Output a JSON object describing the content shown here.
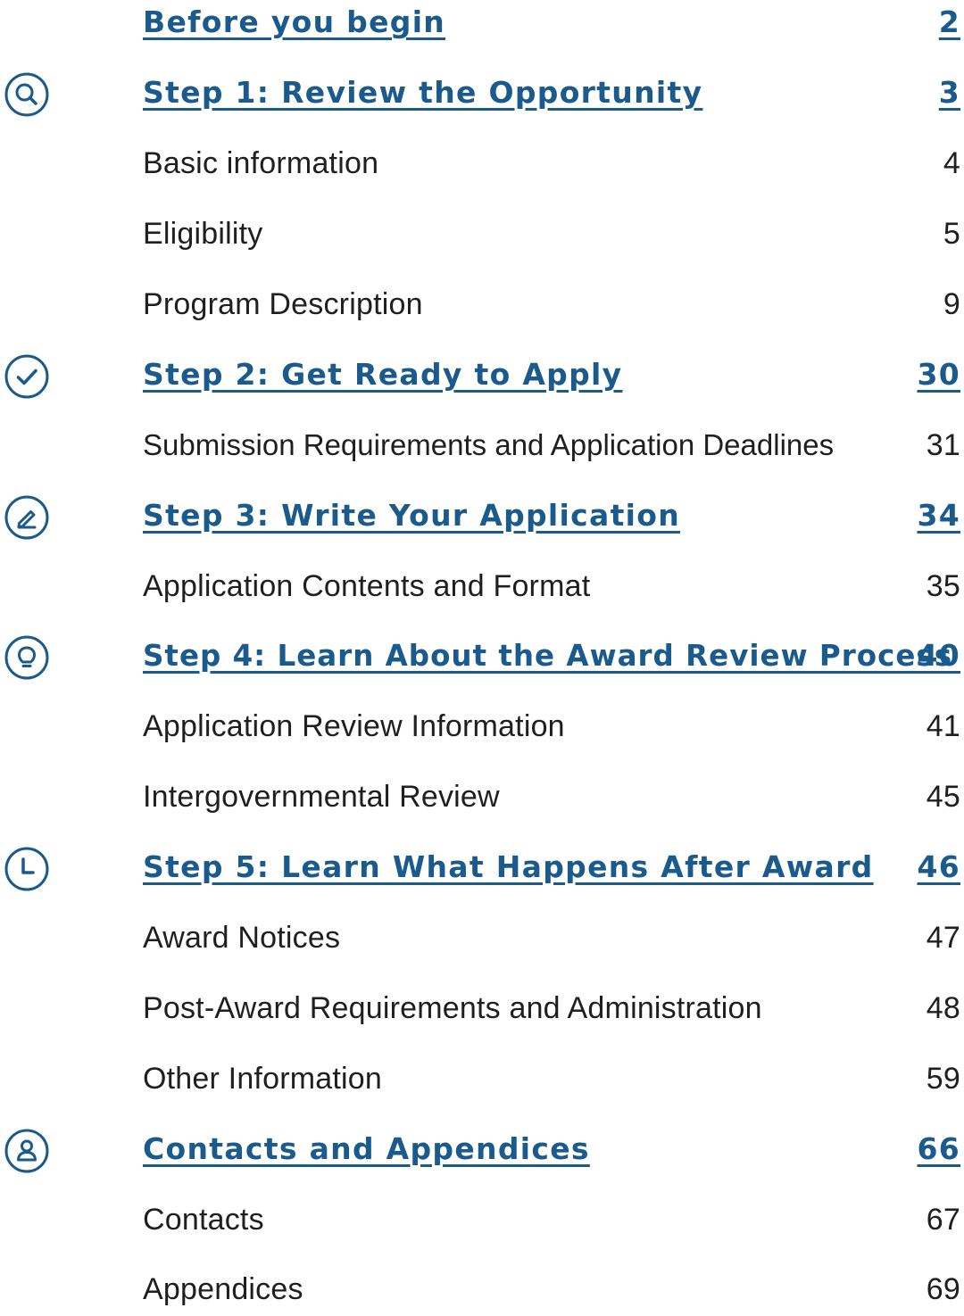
{
  "colors": {
    "heading": "#1a5a8c",
    "icon": "#1a5a8c",
    "text": "#1f1f1f"
  },
  "toc": [
    {
      "type": "heading",
      "title": "Before you begin",
      "page": "2"
    },
    {
      "type": "heading",
      "title": "Step 1: Review the Opportunity",
      "page": "3",
      "icon": "search-icon"
    },
    {
      "type": "sub",
      "title": "Basic information",
      "page": "4"
    },
    {
      "type": "sub",
      "title": "Eligibility",
      "page": "5"
    },
    {
      "type": "sub",
      "title": "Program Description",
      "page": "9"
    },
    {
      "type": "heading",
      "title": "Step 2: Get Ready to Apply",
      "page": "30",
      "icon": "checkmark-icon"
    },
    {
      "type": "sub",
      "title": "Submission Requirements and Application Deadlines",
      "page": "31"
    },
    {
      "type": "heading",
      "title": "Step 3: Write Your Application",
      "page": "34",
      "icon": "pencil-icon"
    },
    {
      "type": "sub",
      "title": "Application Contents and Format",
      "page": "35"
    },
    {
      "type": "heading",
      "title": "Step 4: Learn About the Award Review Process",
      "page": "40",
      "icon": "lightbulb-icon"
    },
    {
      "type": "sub",
      "title": "Application Review Information",
      "page": "41"
    },
    {
      "type": "sub",
      "title": "Intergovernmental Review",
      "page": "45"
    },
    {
      "type": "heading",
      "title": "Step 5: Learn What Happens After Award",
      "page": "46",
      "icon": "clock-icon"
    },
    {
      "type": "sub",
      "title": "Award Notices",
      "page": "47"
    },
    {
      "type": "sub",
      "title": "Post-Award Requirements and Administration",
      "page": "48"
    },
    {
      "type": "sub",
      "title": "Other Information",
      "page": "59"
    },
    {
      "type": "heading",
      "title": "Contacts and Appendices",
      "page": "66",
      "icon": "person-icon"
    },
    {
      "type": "sub",
      "title": "Contacts",
      "page": "67"
    },
    {
      "type": "sub",
      "title": "Appendices",
      "page": "69"
    }
  ]
}
